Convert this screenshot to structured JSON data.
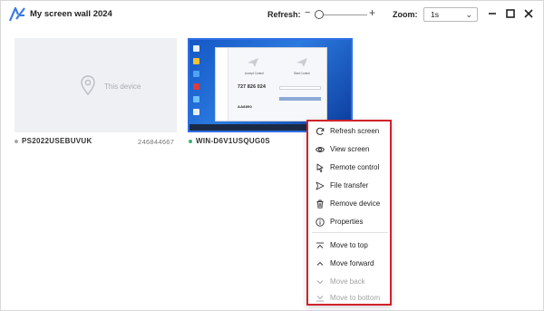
{
  "window": {
    "title": "My screen wall 2024",
    "refresh_label": "Refresh:",
    "zoom_label": "Zoom:",
    "zoom_value": "1s",
    "refresh_level": 0.05
  },
  "devices": [
    {
      "name": "PS2022USEBUVUK",
      "id": "246844667",
      "thumb_text": "This device",
      "status_color": "#a8a8a8"
    },
    {
      "name": "WIN-D6V1USQUG0S",
      "status_color": "#3cb371",
      "screen": {
        "left_panel_title": "Accept Control",
        "right_panel_title": "Start Control",
        "code": "727 826 024",
        "password": "AA8890"
      }
    }
  ],
  "context_menu": {
    "items": [
      {
        "label": "Refresh screen",
        "icon": "refresh-icon",
        "enabled": true
      },
      {
        "label": "View screen",
        "icon": "eye-icon",
        "enabled": true
      },
      {
        "label": "Remote control",
        "icon": "remote-control-icon",
        "enabled": true
      },
      {
        "label": "File transfer",
        "icon": "send-icon",
        "enabled": true
      },
      {
        "label": "Remove device",
        "icon": "trash-icon",
        "enabled": true
      },
      {
        "label": "Properties",
        "icon": "info-icon",
        "enabled": true
      }
    ],
    "order_items": [
      {
        "label": "Move to top",
        "icon": "move-top-icon",
        "enabled": true
      },
      {
        "label": "Move forward",
        "icon": "chevron-up-icon",
        "enabled": true
      },
      {
        "label": "Move back",
        "icon": "chevron-down-icon",
        "enabled": false
      },
      {
        "label": "Move to bottom",
        "icon": "move-bottom-icon",
        "enabled": false
      }
    ],
    "highlight_color": "#d0222b"
  },
  "colors": {
    "accent": "#2f6fe4",
    "logo": "#3a7be0"
  }
}
